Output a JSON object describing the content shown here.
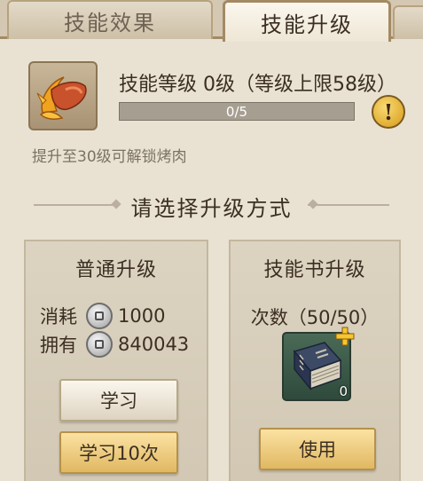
{
  "tabs": [
    {
      "label": "技能效果",
      "active": false
    },
    {
      "label": "技能升级",
      "active": true
    }
  ],
  "skill": {
    "icon": "roast-meat-icon",
    "level_text": "技能等级 0级（等级上限58级）",
    "progress": {
      "current": 0,
      "max": 5,
      "label": "0/5"
    },
    "unlock_hint": "提升至30级可解锁烤肉"
  },
  "section_title": "请选择升级方式",
  "normal_upgrade": {
    "title": "普通升级",
    "cost_label": "消耗",
    "cost_value": "1000",
    "own_label": "拥有",
    "own_value": "840043",
    "currency_icon": "silver-coin-icon",
    "learn_button": "学习",
    "learn10_button": "学习10次"
  },
  "book_upgrade": {
    "title": "技能书升级",
    "times_text": "次数（50/50）",
    "book_icon": "skill-book-icon",
    "book_count": "0",
    "use_button": "使用"
  },
  "colors": {
    "background": "#e9e2d2",
    "accent_gold": "#e0b862",
    "progress_fill": "#e3b34c",
    "alert": "#d79a18"
  }
}
